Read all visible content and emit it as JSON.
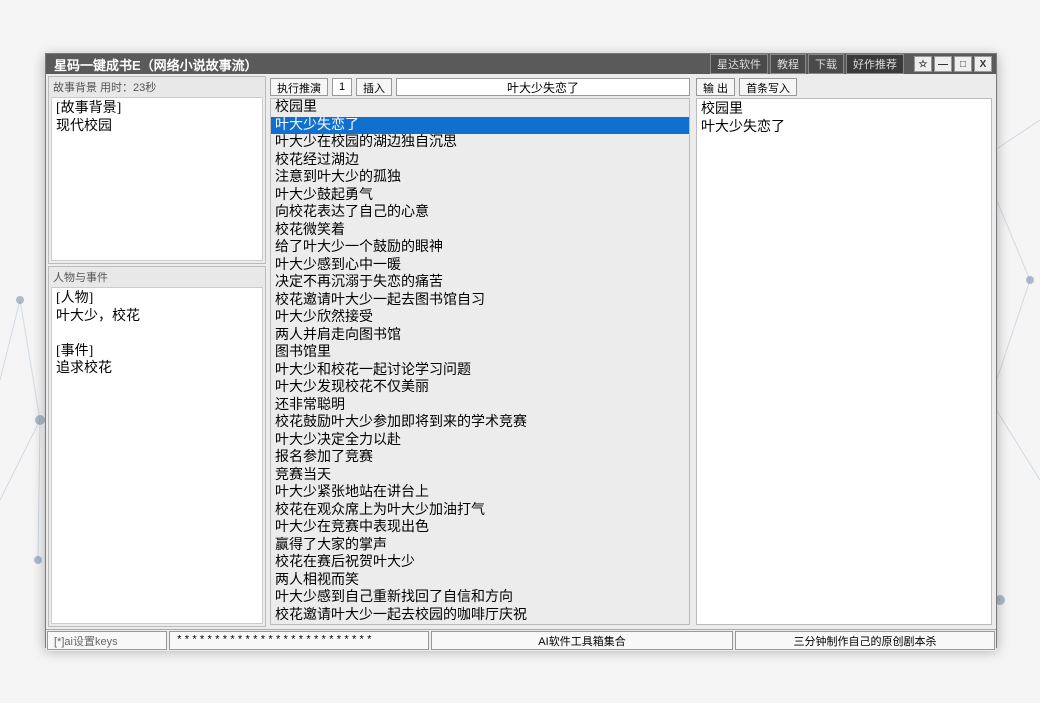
{
  "titlebar": {
    "title": "星码一键成书E（网络小说故事流）",
    "links": [
      "星达软件",
      "教程",
      "下载"
    ],
    "highlight_link": "好作推荐",
    "ctrl_pin": "☆",
    "ctrl_min": "—",
    "ctrl_max": "□",
    "ctrl_close": "X"
  },
  "left": {
    "bg_header": "故事背景  用时：23秒",
    "bg_text": "[故事背景]\n现代校园",
    "char_header": "人物与事件",
    "char_text": "[人物]\n叶大少，校花\n\n[事件]\n追求校花"
  },
  "mid": {
    "btn_run": "执行推演",
    "count": "1",
    "btn_insert": "插入",
    "topic": "叶大少失恋了",
    "selected_index": 1,
    "lines": [
      "校园里",
      "叶大少失恋了",
      "叶大少在校园的湖边独自沉思",
      "校花经过湖边",
      "注意到叶大少的孤独",
      "叶大少鼓起勇气",
      "向校花表达了自己的心意",
      "校花微笑着",
      "给了叶大少一个鼓励的眼神",
      "叶大少感到心中一暖",
      "决定不再沉溺于失恋的痛苦",
      "校花邀请叶大少一起去图书馆自习",
      "叶大少欣然接受",
      "两人并肩走向图书馆",
      "图书馆里",
      "叶大少和校花一起讨论学习问题",
      "叶大少发现校花不仅美丽",
      "还非常聪明",
      "校花鼓励叶大少参加即将到来的学术竞赛",
      "叶大少决定全力以赴",
      "报名参加了竞赛",
      "竞赛当天",
      "叶大少紧张地站在讲台上",
      "校花在观众席上为叶大少加油打气",
      "叶大少在竞赛中表现出色",
      "赢得了大家的掌声",
      "校花在赛后祝贺叶大少",
      "两人相视而笑",
      "叶大少感到自己重新找回了自信和方向",
      "校花邀请叶大少一起去校园的咖啡厅庆祝"
    ]
  },
  "right": {
    "btn_output": "输 出",
    "btn_first": "首条写入",
    "text": "校园里\n叶大少失恋了"
  },
  "footer": {
    "keys": "[*]ai设置keys",
    "pwd": "**************************",
    "mid": "AI软件工具箱集合",
    "right": "三分钟制作自己的原创剧本杀"
  }
}
